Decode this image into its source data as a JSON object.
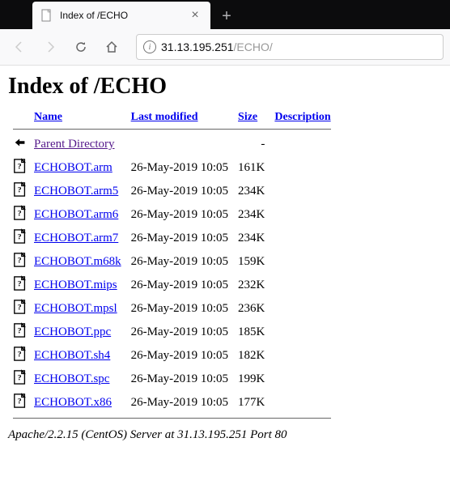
{
  "tab": {
    "title": "Index of /ECHO"
  },
  "url": {
    "host": "31.13.195.251",
    "path": "/ECHO/"
  },
  "page": {
    "heading": "Index of /ECHO",
    "columns": {
      "name": "Name",
      "modified": "Last modified",
      "size": "Size",
      "description": "Description"
    },
    "parent": {
      "label": "Parent Directory",
      "size": "-"
    },
    "files": [
      {
        "name": "ECHOBOT.arm",
        "modified": "26-May-2019 10:05",
        "size": "161K"
      },
      {
        "name": "ECHOBOT.arm5",
        "modified": "26-May-2019 10:05",
        "size": "234K"
      },
      {
        "name": "ECHOBOT.arm6",
        "modified": "26-May-2019 10:05",
        "size": "234K"
      },
      {
        "name": "ECHOBOT.arm7",
        "modified": "26-May-2019 10:05",
        "size": "234K"
      },
      {
        "name": "ECHOBOT.m68k",
        "modified": "26-May-2019 10:05",
        "size": "159K"
      },
      {
        "name": "ECHOBOT.mips",
        "modified": "26-May-2019 10:05",
        "size": "232K"
      },
      {
        "name": "ECHOBOT.mpsl",
        "modified": "26-May-2019 10:05",
        "size": "236K"
      },
      {
        "name": "ECHOBOT.ppc",
        "modified": "26-May-2019 10:05",
        "size": "185K"
      },
      {
        "name": "ECHOBOT.sh4",
        "modified": "26-May-2019 10:05",
        "size": "182K"
      },
      {
        "name": "ECHOBOT.spc",
        "modified": "26-May-2019 10:05",
        "size": "199K"
      },
      {
        "name": "ECHOBOT.x86",
        "modified": "26-May-2019 10:05",
        "size": "177K"
      }
    ],
    "footer": "Apache/2.2.15 (CentOS) Server at 31.13.195.251 Port 80"
  }
}
